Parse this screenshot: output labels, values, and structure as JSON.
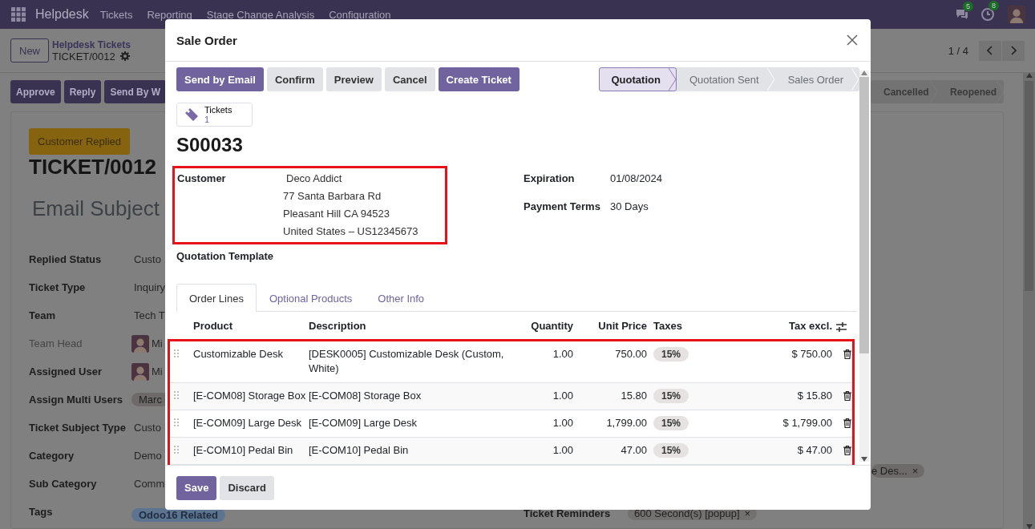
{
  "navbar": {
    "app": "Helpdesk",
    "menus": [
      "Tickets",
      "Reporting",
      "Stage Change Analysis",
      "Configuration"
    ],
    "badges": [
      {
        "kind": "chat",
        "count": "5"
      },
      {
        "kind": "activity",
        "count": "8"
      }
    ]
  },
  "control_panel": {
    "new_button": "New",
    "breadcrumb": "Helpdesk Tickets",
    "record": "TICKET/0012",
    "pager": "1 / 4"
  },
  "action_buttons": [
    "Approve",
    "Reply",
    "Send By W"
  ],
  "stages": [
    {
      "label": "Cancelled",
      "selected": false
    },
    {
      "label": "Reopened",
      "selected": false
    }
  ],
  "ticket": {
    "status_badge": "Customer Replied",
    "title": "TICKET/0012",
    "subject": "Email Subject",
    "fields": [
      {
        "label": "Replied Status",
        "value": "Custo",
        "kind": "text",
        "readonly": false
      },
      {
        "label": "Ticket Type",
        "value": "Inquiry",
        "kind": "text",
        "readonly": false
      },
      {
        "label": "Team",
        "value": "Tech T",
        "kind": "text",
        "readonly": false
      },
      {
        "label": "Team Head",
        "value": "Mi",
        "kind": "user",
        "readonly": true
      },
      {
        "label": "Assigned User",
        "value": "Mi",
        "kind": "user",
        "readonly": false
      },
      {
        "label": "Assign Multi Users",
        "value": "Marc",
        "kind": "tag",
        "readonly": false
      },
      {
        "label": "Ticket Subject Type",
        "value": "Custo",
        "kind": "text",
        "readonly": false
      },
      {
        "label": "Category",
        "value": "Demo",
        "kind": "text",
        "readonly": false
      },
      {
        "label": "Sub Category",
        "value": "Comm",
        "kind": "text",
        "readonly": false
      },
      {
        "label": "Tags",
        "value": "Odoo16 Related",
        "kind": "tag",
        "readonly": false
      }
    ],
    "side_tag": {
      "text": "e Des...",
      "remove": "×"
    },
    "reminders": {
      "label": "Ticket Reminders",
      "tag": "600 Second(s) [popup]",
      "remove": "×"
    }
  },
  "dialog": {
    "title": "Sale Order",
    "buttons": [
      {
        "label": "Send by Email",
        "primary": true
      },
      {
        "label": "Confirm",
        "primary": false
      },
      {
        "label": "Preview",
        "primary": false
      },
      {
        "label": "Cancel",
        "primary": false
      },
      {
        "label": "Create Ticket",
        "primary": true
      }
    ],
    "stages": [
      {
        "label": "Quotation",
        "selected": true
      },
      {
        "label": "Quotation Sent",
        "selected": false
      },
      {
        "label": "Sales Order",
        "selected": false
      }
    ],
    "smart_button": {
      "label": "Tickets",
      "count": "1"
    },
    "name": "S00033",
    "customer": {
      "label": "Customer",
      "name": "Deco Addict",
      "address": [
        "77 Santa Barbara Rd",
        "Pleasant Hill CA 94523",
        "United States – US12345673"
      ],
      "highlighted": true
    },
    "right_fields": [
      {
        "label": "Expiration",
        "value": "01/08/2024"
      },
      {
        "label": "Payment Terms",
        "value": "30 Days"
      }
    ],
    "template_label": "Quotation Template",
    "tabs": [
      {
        "label": "Order Lines",
        "selected": true
      },
      {
        "label": "Optional Products",
        "selected": false
      },
      {
        "label": "Other Info",
        "selected": false
      }
    ],
    "columns": [
      "Product",
      "Description",
      "Quantity",
      "Unit Price",
      "Taxes",
      "Tax excl."
    ],
    "lines_highlighted": true,
    "lines": [
      {
        "product": "Customizable Desk",
        "description": "[DESK0005] Customizable Desk (Custom, White)",
        "quantity": "1.00",
        "unit_price": "750.00",
        "taxes": "15%",
        "subtotal": "$ 750.00"
      },
      {
        "product": "[E-COM08] Storage Box",
        "description": "[E-COM08] Storage Box",
        "quantity": "1.00",
        "unit_price": "15.80",
        "taxes": "15%",
        "subtotal": "$ 15.80"
      },
      {
        "product": "[E-COM09] Large Desk",
        "description": "[E-COM09] Large Desk",
        "quantity": "1.00",
        "unit_price": "1,799.00",
        "taxes": "15%",
        "subtotal": "$ 1,799.00"
      },
      {
        "product": "[E-COM10] Pedal Bin",
        "description": "[E-COM10] Pedal Bin",
        "quantity": "1.00",
        "unit_price": "47.00",
        "taxes": "15%",
        "subtotal": "$ 47.00"
      }
    ],
    "footer_buttons": [
      {
        "label": "Save",
        "primary": true
      },
      {
        "label": "Discard",
        "primary": false
      }
    ]
  }
}
